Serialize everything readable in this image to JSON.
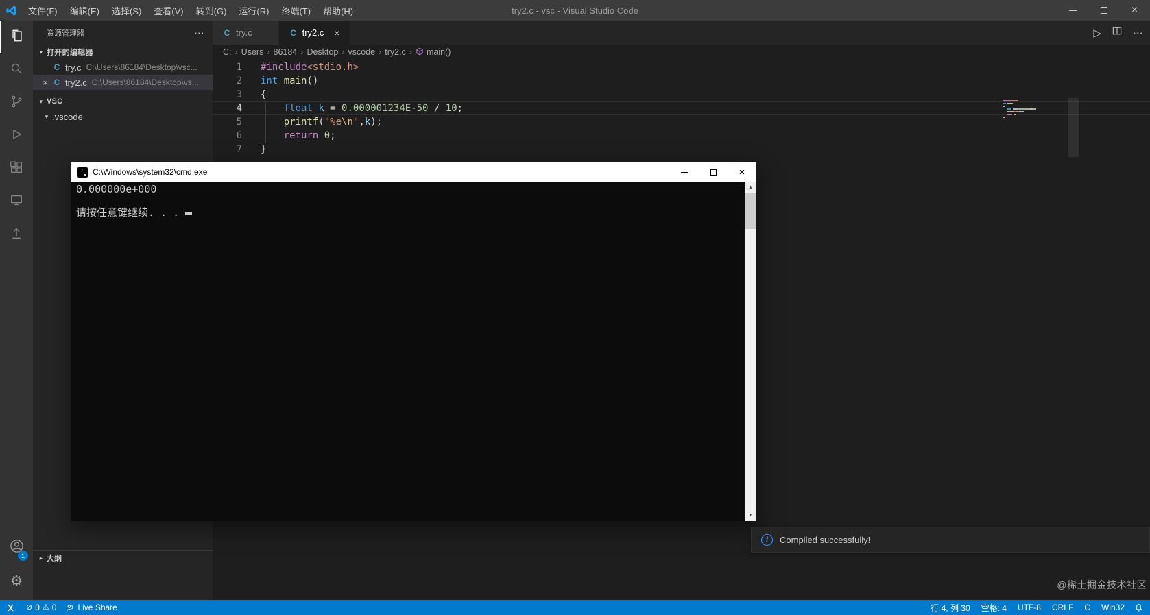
{
  "title_bar": {
    "menus": [
      "文件(F)",
      "编辑(E)",
      "选择(S)",
      "查看(V)",
      "转到(G)",
      "运行(R)",
      "终端(T)",
      "帮助(H)"
    ],
    "title": "try2.c - vsc - Visual Studio Code"
  },
  "activity_bar": {
    "account_badge": "1"
  },
  "sidebar": {
    "header": "资源管理器",
    "sections": {
      "open_editors": "打开的编辑器",
      "workspace": "VSC",
      "outline": "大纲"
    },
    "open_files": [
      {
        "name": "try.c",
        "path": "C:\\Users\\86184\\Desktop\\vsc..."
      },
      {
        "name": "try2.c",
        "path": "C:\\Users\\86184\\Desktop\\vs..."
      }
    ],
    "workspace_children": [
      ".vscode"
    ]
  },
  "tab_bar": {
    "tabs": [
      {
        "label": "try.c",
        "active": false
      },
      {
        "label": "try2.c",
        "active": true
      }
    ]
  },
  "breadcrumb": [
    "C:",
    "Users",
    "86184",
    "Desktop",
    "vscode",
    "try2.c",
    "main()"
  ],
  "editor": {
    "lines": [
      {
        "num": "1",
        "tokens": [
          {
            "t": "#include",
            "c": "#C586C0"
          },
          {
            "t": "<stdio.h>",
            "c": "#CE9178"
          }
        ]
      },
      {
        "num": "2",
        "tokens": [
          {
            "t": "int",
            "c": "#569CD6"
          },
          {
            "t": " ",
            "c": ""
          },
          {
            "t": "main",
            "c": "#DCDCAA"
          },
          {
            "t": "()",
            "c": "#D4D4D4"
          }
        ]
      },
      {
        "num": "3",
        "tokens": [
          {
            "t": "{",
            "c": "#D4D4D4"
          }
        ]
      },
      {
        "num": "4",
        "current": true,
        "tokens": [
          {
            "t": "    ",
            "c": ""
          },
          {
            "t": "float",
            "c": "#569CD6"
          },
          {
            "t": " ",
            "c": ""
          },
          {
            "t": "k",
            "c": "#9CDCFE"
          },
          {
            "t": " = ",
            "c": "#D4D4D4"
          },
          {
            "t": "0.000001234E-50",
            "c": "#B5CEA8"
          },
          {
            "t": " / ",
            "c": "#D4D4D4"
          },
          {
            "t": "10",
            "c": "#B5CEA8"
          },
          {
            "t": ";",
            "c": "#D4D4D4"
          }
        ]
      },
      {
        "num": "5",
        "tokens": [
          {
            "t": "    ",
            "c": ""
          },
          {
            "t": "printf",
            "c": "#DCDCAA"
          },
          {
            "t": "(",
            "c": "#D4D4D4"
          },
          {
            "t": "\"%e",
            "c": "#CE9178"
          },
          {
            "t": "\\n",
            "c": "#D7BA7D"
          },
          {
            "t": "\"",
            "c": "#CE9178"
          },
          {
            "t": ",",
            "c": "#D4D4D4"
          },
          {
            "t": "k",
            "c": "#9CDCFE"
          },
          {
            "t": ");",
            "c": "#D4D4D4"
          }
        ]
      },
      {
        "num": "6",
        "tokens": [
          {
            "t": "    ",
            "c": ""
          },
          {
            "t": "return",
            "c": "#C586C0"
          },
          {
            "t": " ",
            "c": ""
          },
          {
            "t": "0",
            "c": "#B5CEA8"
          },
          {
            "t": ";",
            "c": "#D4D4D4"
          }
        ]
      },
      {
        "num": "7",
        "tokens": [
          {
            "t": "}",
            "c": "#D4D4D4"
          }
        ]
      }
    ]
  },
  "cmd_window": {
    "title": "C:\\Windows\\system32\\cmd.exe",
    "lines": [
      "0.000000e+000",
      "",
      "请按任意键继续. . ."
    ]
  },
  "notification": {
    "message": "Compiled successfully!"
  },
  "status_bar": {
    "errors": "0",
    "warnings": "0",
    "live_share": "Live Share",
    "cursor": "行 4, 列 30",
    "spaces": "空格: 4",
    "encoding": "UTF-8",
    "eol": "CRLF",
    "language": "C",
    "platform": "Win32"
  },
  "watermark": "@稀土掘金技术社区",
  "icons": {
    "c_file": "C",
    "close": "×",
    "ellipsis": "⋯",
    "chevron_down": "▾",
    "chevron_right": "▸",
    "breadcrumb_sep": "›",
    "run": "▷",
    "error": "⊘",
    "warning": "⚠",
    "arrow_up": "▲",
    "arrow_down": "▼",
    "info": "i"
  },
  "colors": {
    "status_bar": "#007ACC",
    "title_bar": "#3C3C3C",
    "activity_bar": "#333333",
    "sidebar": "#252526",
    "editor_bg": "#1E1E1E",
    "cmd_bg": "#0C0C0C",
    "c_icon": "#519ABA",
    "info_accent": "#3794FF"
  }
}
